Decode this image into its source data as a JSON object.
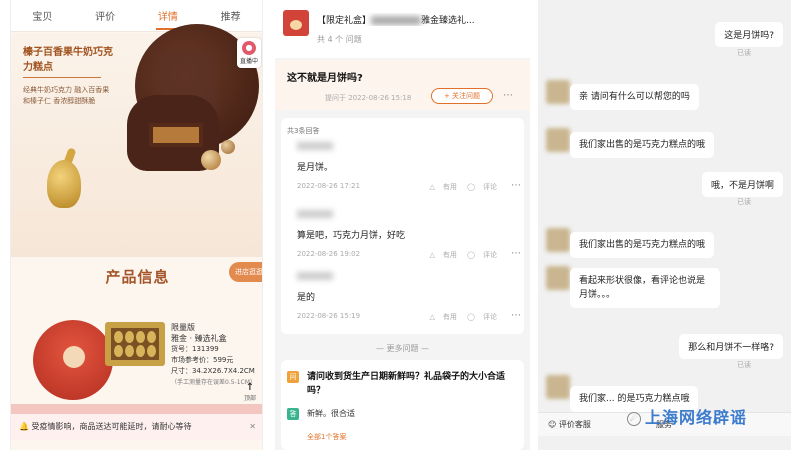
{
  "panel1": {
    "tabs": [
      "宝贝",
      "评价",
      "详情",
      "推荐"
    ],
    "hero_title": "榛子百香果牛奶巧克力糕点",
    "hero_desc": "经典牛奶巧克力 融入百香果和榛子仁 香浓醇甜酥脆",
    "live_label": "直播中",
    "section_title": "产品信息",
    "enter_btn": "进店逛逛",
    "spec": {
      "line1": "限量版",
      "line2": "雅金 · 臻选礼盒",
      "line3": "货号：131399",
      "line4": "市场参考价：599元",
      "line5": "尺寸：34.2X26.7X4.2CM",
      "line6": "（手工测量存在误差0.5-1CM）"
    },
    "top_btn": "顶部",
    "notice": "受疫情影响，商品送达可能延时，请耐心等待",
    "colors": {
      "accent": "#e0702a",
      "title": "#a4552a"
    }
  },
  "panel2": {
    "title": "【限定礼盒】",
    "title_suffix": "雅金臻选礼...",
    "question_count": "共 4 个 问题",
    "question": "这不就是月饼吗?",
    "question_meta": "提问于 2022-08-26 15:18",
    "follow_btn": "+ 关注问题",
    "answer_count": "共3条回答",
    "answers": [
      {
        "text": "是月饼。",
        "time": "2022-08-26 17:21",
        "useful": "有用",
        "comment": "评论"
      },
      {
        "text": "算是吧，巧克力月饼，好吃",
        "time": "2022-08-26 19:02",
        "useful": "有用",
        "comment": "评论"
      },
      {
        "text": "是的",
        "time": "2022-08-26 15:19",
        "useful": "有用",
        "comment": "评论"
      }
    ],
    "more_questions": "更多问题",
    "q2_badge": "问",
    "q2_text": "请问收到货生产日期新鲜吗？礼品袋子的大小合适吗？",
    "a2_badge": "答",
    "a2_text": "新鲜。很合适",
    "all_answers": "全部1个答案"
  },
  "panel3": {
    "messages": [
      {
        "side": "right",
        "text": "这是月饼吗?",
        "status": "已读"
      },
      {
        "side": "left",
        "text": "亲 请问有什么可以帮您的吗"
      },
      {
        "side": "left",
        "text": "我们家出售的是巧克力糕点的哦"
      },
      {
        "side": "right",
        "text": "哦，不是月饼啊",
        "status": "已读"
      },
      {
        "side": "left",
        "text": "我们家出售的是巧克力糕点的哦"
      },
      {
        "side": "left",
        "text": "看起来形状很像，看评论也说是月饼。。。"
      },
      {
        "side": "right",
        "text": "那么和月饼不一样咯?",
        "status": "已读"
      },
      {
        "side": "left",
        "text": "我们家... 的是巧克力糕点哦"
      }
    ],
    "bottom": {
      "rate": "评价客服",
      "service": "服务"
    },
    "watermark": "上海网络辟谣"
  }
}
